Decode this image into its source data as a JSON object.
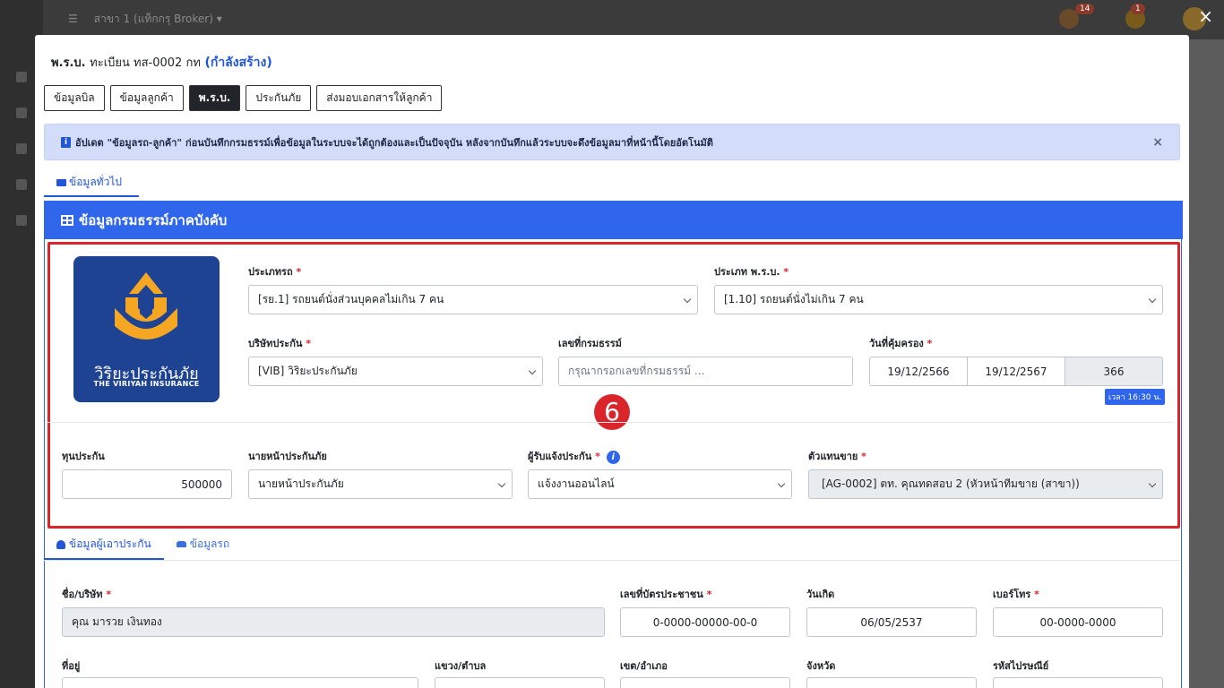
{
  "background": {
    "branch_label": "สาขา 1 (แท็กกรุ Broker)",
    "badge_1": "14",
    "badge_2": "1"
  },
  "overlay": {
    "close_label": "×"
  },
  "modal": {
    "title_prefix": "พ.ร.บ.",
    "title_reg": "ทะเบียน ทส-0002 กท",
    "title_status": "(กำลังสร้าง)"
  },
  "tabs": [
    {
      "label": "ข้อมูลบิล"
    },
    {
      "label": "ข้อมูลลูกค้า"
    },
    {
      "label": "พ.ร.บ."
    },
    {
      "label": "ประกันภัย"
    },
    {
      "label": "ส่งมอบเอกสารให้ลูกค้า"
    }
  ],
  "alert": {
    "text": "อัปเดต \"ข้อมูลรถ-ลูกค้า\" ก่อนบันทึกกรมธรรม์เพื่อข้อมูลในระบบจะได้ถูกต้องและเป็นปัจจุบัน หลังจากบันทึกแล้วระบบจะดึงข้อมูลมาที่หน้านี้โดยอัตโนมัติ",
    "close": "×"
  },
  "subtab": {
    "label": "ข้อมูลทั่วไป"
  },
  "section": {
    "title": "ข้อมูลกรมธรรม์ภาคบังคับ"
  },
  "logo": {
    "name_th": "วิริยะประกันภัย",
    "name_en": "THE VIRIYAH INSURANCE"
  },
  "form": {
    "car_type": {
      "label": "ประเภทรถ",
      "value": "[รย.1] รถยนต์นั่งส่วนบุคคลไม่เกิน 7 คน"
    },
    "prb_type": {
      "label": "ประเภท พ.ร.บ.",
      "value": "[1.10] รถยนต์นั่งไม่เกิน 7 คน"
    },
    "insurer": {
      "label": "บริษัทประกัน",
      "value": "[VIB] วิริยะประกันภัย"
    },
    "policy_no": {
      "label": "เลขที่กรมธรรม์",
      "placeholder": "กรุณากรอกเลขที่กรมธรรม์ ..."
    },
    "coverage": {
      "label": "วันที่คุ้มครอง",
      "start": "19/12/2566",
      "end": "19/12/2567",
      "days": "366",
      "time_badge": "เวลา 16:30 น."
    },
    "sum_insured": {
      "label": "ทุนประกัน",
      "value": "500000"
    },
    "broker": {
      "label": "นายหน้าประกันภัย",
      "value": "นายหน้าประกันภัย"
    },
    "notifier": {
      "label": "ผู้รับแจ้งประกัน",
      "value": "แจ้งงานออนไลน์"
    },
    "agent": {
      "label": "ตัวแทนขาย",
      "value": "[AG-0002] ตท. คุณทดสอบ 2 (หัวหน้าทีมขาย (สาขา))"
    },
    "required_mark": "*",
    "step_number": "6"
  },
  "tabs2": [
    {
      "label": "ข้อมูลผู้เอาประกัน"
    },
    {
      "label": "ข้อมูลรถ"
    }
  ],
  "insured": {
    "name": {
      "label": "ชื่อ/บริษัท",
      "value": "คุณ มารวย เงินทอง"
    },
    "id_card": {
      "label": "เลขที่บัตรประชาชน",
      "value": "0-0000-00000-00-0"
    },
    "birth": {
      "label": "วันเกิด",
      "value": "06/05/2537"
    },
    "phone": {
      "label": "เบอร์โทร",
      "value": "00-0000-0000"
    },
    "address": {
      "label": "ที่อยู่"
    },
    "subdistrict": {
      "label": "แขวง/ตำบล"
    },
    "district": {
      "label": "เขต/อำเภอ"
    },
    "province": {
      "label": "จังหวัด"
    },
    "postcode": {
      "label": "รหัสไปรษณีย์"
    }
  }
}
